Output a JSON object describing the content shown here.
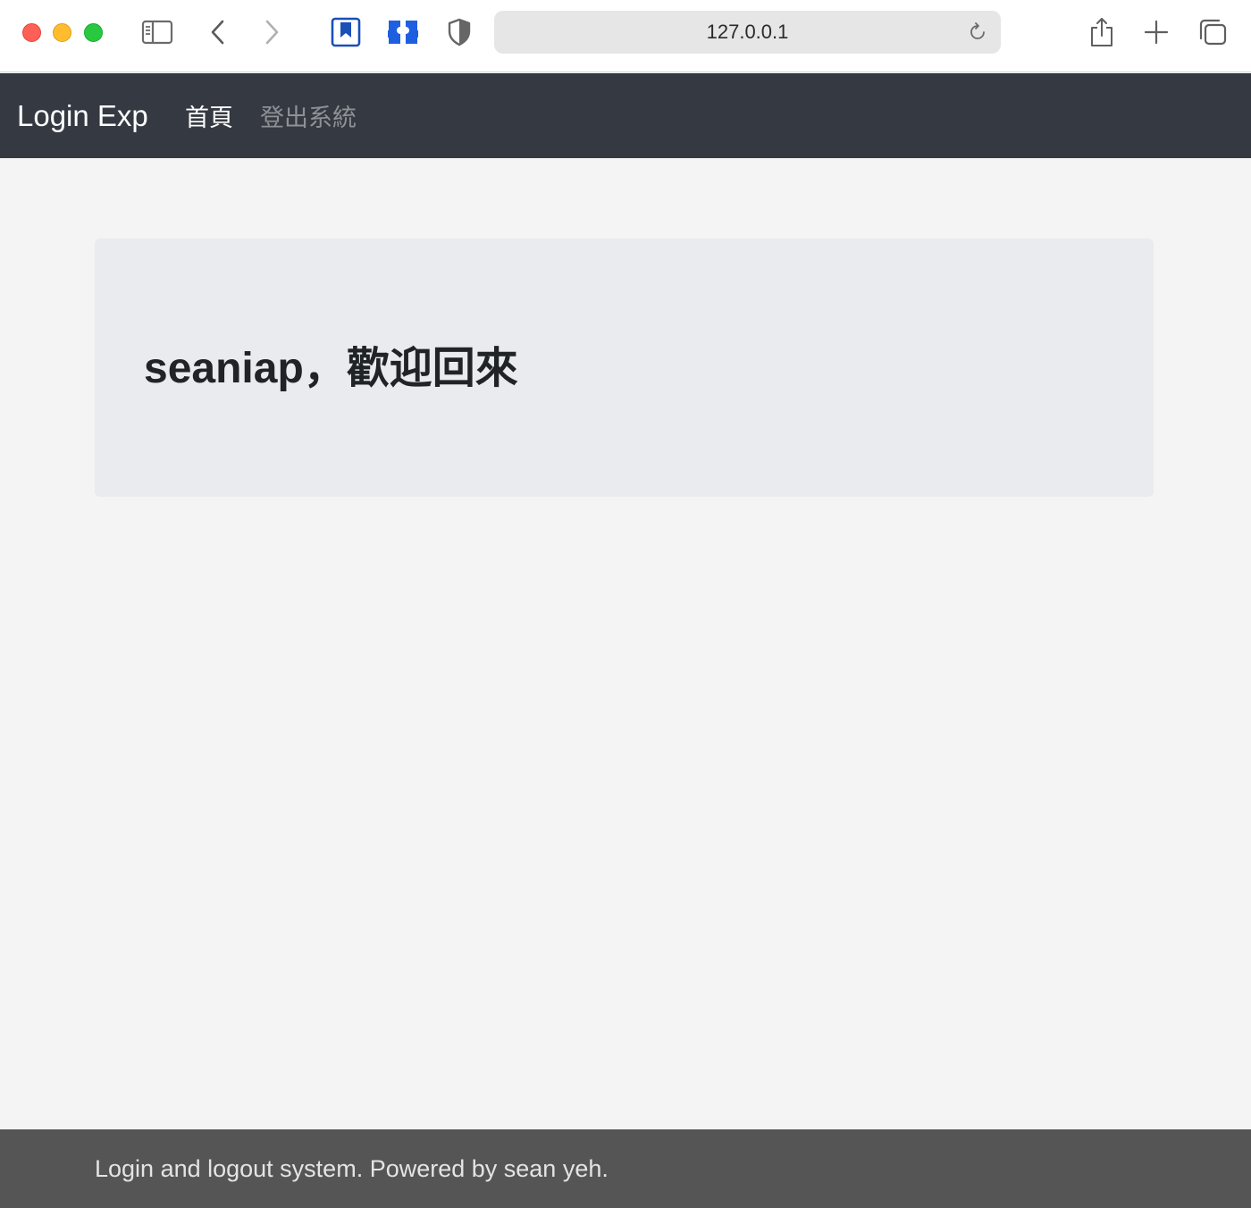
{
  "browser": {
    "url": "127.0.0.1",
    "colors": {
      "close": "#fe5f57",
      "minimize": "#febc2e",
      "zoom": "#28c840"
    },
    "toolbar_icons": [
      "sidebar-icon",
      "back-icon",
      "forward-icon",
      "bookmark-icon",
      "extension-icon",
      "shield-icon",
      "reload-icon",
      "share-icon",
      "new-tab-icon",
      "tabs-overview-icon"
    ]
  },
  "navbar": {
    "brand": "Login Exp",
    "links": [
      {
        "label": "首頁",
        "active": true
      },
      {
        "label": "登出系統",
        "active": false
      }
    ],
    "background": "#353a42"
  },
  "main": {
    "welcome_message": "seaniap，歡迎回來",
    "panel_background": "#eaebee"
  },
  "footer": {
    "text": "Login and logout system. Powered by sean yeh.",
    "background": "#555555"
  }
}
